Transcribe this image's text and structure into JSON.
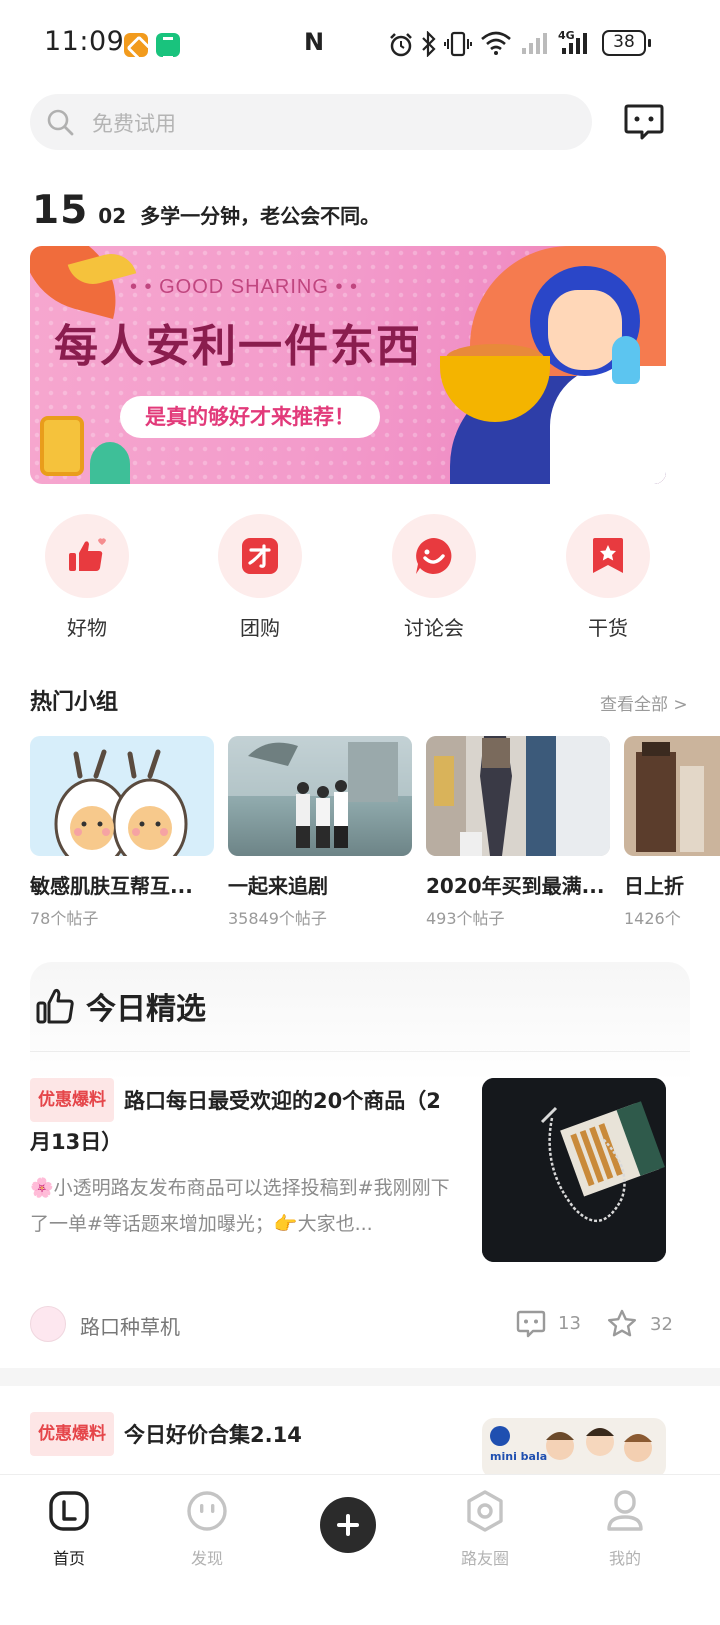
{
  "status_bar": {
    "time": "11:09",
    "nfc": "N",
    "battery": "38",
    "network": "4G"
  },
  "search": {
    "placeholder": "免费试用"
  },
  "date": {
    "day": "15",
    "month": "02",
    "slogan": "多学一分钟，老公会不同。"
  },
  "banner": {
    "subtitle": "• • GOOD SHARING • •",
    "title": "每人安利一件东西",
    "pill": "是真的够好才来推荐！"
  },
  "categories": [
    {
      "label": "好物",
      "icon": "thumbs-up-heart-icon"
    },
    {
      "label": "团购",
      "icon": "group-buy-icon"
    },
    {
      "label": "讨论会",
      "icon": "smile-bubble-icon"
    },
    {
      "label": "干货",
      "icon": "bookmark-star-icon"
    }
  ],
  "hot_groups": {
    "title": "热门小组",
    "see_all": "查看全部 >",
    "items": [
      {
        "name": "敏感肌肤互帮互...",
        "count": "78个帖子"
      },
      {
        "name": "一起来追剧",
        "count": "35849个帖子"
      },
      {
        "name": "2020年买到最满...",
        "count": "493个帖子"
      },
      {
        "name": "日上折",
        "count": "1426个"
      }
    ]
  },
  "picks": {
    "title": "今日精选",
    "articles": [
      {
        "tag": "优惠爆料",
        "title": "路口每日最受欢迎的20个商品（2月13日）",
        "desc": "🌸小透明路友发布商品可以选择投稿到#我刚刚下了一单#等话题来增加曝光；👉大家也...",
        "author": "路口种草机",
        "comments": "13",
        "stars": "32"
      },
      {
        "tag": "优惠爆料",
        "title": "今日好价合集2.14",
        "thumb_text": "mini bala"
      }
    ]
  },
  "bottom_nav": [
    {
      "label": "首页",
      "active": true
    },
    {
      "label": "发现",
      "active": false
    },
    {
      "label": "路友圈",
      "active": false
    },
    {
      "label": "我的",
      "active": false
    }
  ],
  "colors": {
    "accent": "#e5464a",
    "tag_bg": "#fde6e6",
    "icon_bg": "#fdeceb"
  }
}
